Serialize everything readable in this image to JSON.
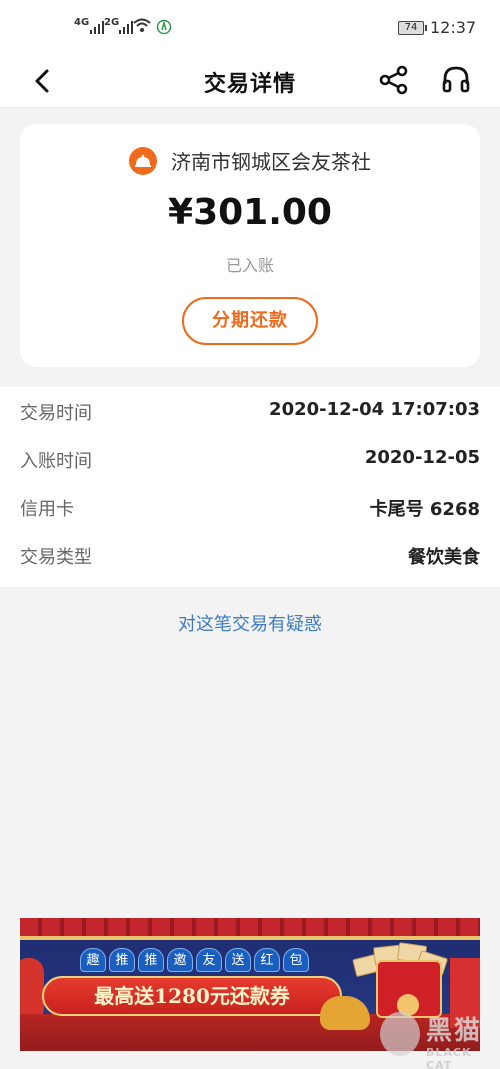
{
  "status_bar": {
    "network_1": "4G",
    "network_2": "2G",
    "battery": "74",
    "time": "12:37"
  },
  "nav": {
    "title": "交易详情"
  },
  "card": {
    "merchant": "济南市钢城区会友茶社",
    "amount": "¥301.00",
    "status": "已入账",
    "installment_button": "分期还款"
  },
  "details": [
    {
      "label": "交易时间",
      "value": "2020-12-04 17:07:03"
    },
    {
      "label": "入账时间",
      "value": "2020-12-05"
    },
    {
      "label": "信用卡",
      "value": "卡尾号 6268"
    },
    {
      "label": "交易类型",
      "value": "餐饮美食"
    }
  ],
  "dispute_link": "对这笔交易有疑惑",
  "banner": {
    "ribbon": [
      "趣",
      "推",
      "推",
      "邀",
      "友",
      "送",
      "红",
      "包"
    ],
    "headline": "最高送1280元还款券"
  },
  "watermark": {
    "text": "黑猫",
    "sub": "BLACK CAT"
  },
  "colors": {
    "accent": "#f06a1c",
    "link": "#3f7cc5"
  }
}
